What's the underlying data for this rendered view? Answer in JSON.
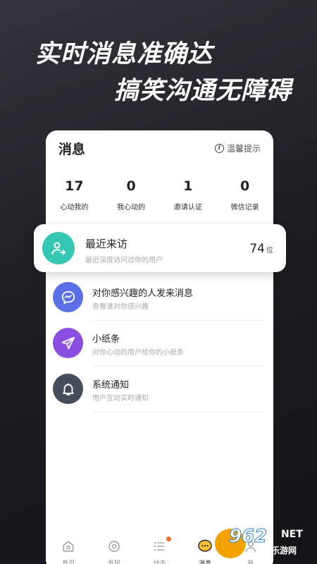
{
  "hero": {
    "line1": "实时消息准确达",
    "line2": "搞笑沟通无障碍"
  },
  "header": {
    "title": "消息",
    "tips": "温馨提示"
  },
  "stats": [
    {
      "num": "17",
      "label": "心动我的"
    },
    {
      "num": "0",
      "label": "我心动的"
    },
    {
      "num": "1",
      "label": "邀请认证"
    },
    {
      "num": "0",
      "label": "微信记录"
    }
  ],
  "visitor": {
    "title": "最近来访",
    "subtitle": "最近深度访问过你的用户",
    "count": "74",
    "unit": "位",
    "icon": "person-arrow-icon",
    "color": "#35c7b4"
  },
  "rows": [
    {
      "title": "对你感兴趣的人发来消息",
      "subtitle": "查看谁对你感兴趣",
      "icon": "chat-bubble-icon",
      "color": "#5b6fe6"
    },
    {
      "title": "小纸条",
      "subtitle": "对你心动的用户给你的小纸条",
      "icon": "paper-plane-icon",
      "color": "#8a4fe0"
    },
    {
      "title": "系统通知",
      "subtitle": "用户互动实时通知",
      "icon": "bell-icon",
      "color": "#454d5a"
    }
  ],
  "tabs": [
    {
      "label": "首页",
      "icon": "home-icon"
    },
    {
      "label": "发现",
      "icon": "compass-icon"
    },
    {
      "label": "动态",
      "icon": "list-icon"
    },
    {
      "label": "消息",
      "icon": "message-icon"
    },
    {
      "label": "我",
      "icon": "user-icon"
    }
  ],
  "watermark": {
    "num": "962",
    "net": "NET",
    "site": "乐游网"
  }
}
